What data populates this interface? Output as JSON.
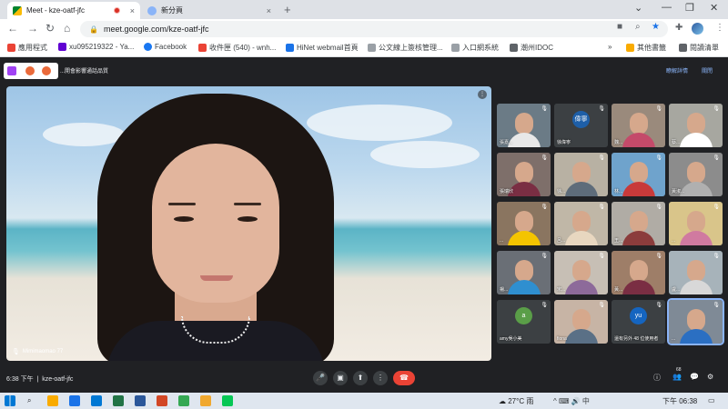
{
  "browser": {
    "tabs": [
      {
        "title": "Meet - kze-oatf-jfc",
        "active": true,
        "close": "×"
      },
      {
        "title": "新分頁",
        "active": false,
        "close": "×"
      }
    ],
    "new_tab": "+",
    "window_controls": {
      "minimize": "—",
      "restore": "❐",
      "close": "✕",
      "menu": "⌄"
    },
    "url": "meet.google.com/kze-oatf-jfc",
    "nav": {
      "back": "←",
      "forward": "→",
      "reload": "↻",
      "home": "⌂"
    },
    "omni_icons": {
      "camera": "■",
      "zoom": "⌕",
      "star": "★"
    },
    "ext_icons": {
      "puzzle": "✚",
      "menu": "⋮"
    }
  },
  "bookmarks": {
    "items": [
      {
        "label": "應用程式",
        "color": "#ea4335"
      },
      {
        "label": "xu095219322 - Ya...",
        "color": "#6001d2"
      },
      {
        "label": "Facebook",
        "color": "#1877f2"
      },
      {
        "label": "收件匣 (540) - wnh...",
        "color": "#ea4335"
      },
      {
        "label": "HiNet webmail首頁",
        "color": "#1a73e8"
      },
      {
        "label": "公文線上簽核管理...",
        "color": "#5f6368"
      },
      {
        "label": "入口網系統",
        "color": "#5f6368"
      },
      {
        "label": "潮州IDOC",
        "color": "#5f6368"
      }
    ],
    "more": "»",
    "other": "其他書籤",
    "reading": "閱讀清單"
  },
  "meet": {
    "strip_title": "...開會影響通話品質",
    "strip_links": [
      "瞭解詳情",
      "關閉"
    ],
    "main_speaker": "Mimimaomao 77",
    "participants": [
      {
        "name": "張嘉...",
        "bg": "#6b7b86",
        "body": "#e8e8e8"
      },
      {
        "name": "徐偉寧",
        "bg": "#3c4043",
        "avatar": "偉寧",
        "avatar_color": "#1e5fa8"
      },
      {
        "name": "魏...",
        "bg": "#9a8a7c",
        "body": "#c44a6a"
      },
      {
        "name": "蔡...",
        "bg": "#a7a7a0",
        "body": "#ffffff"
      },
      {
        "name": "張瑞欣",
        "bg": "#7e6f6a",
        "body": "#7a2e43"
      },
      {
        "name": "徐...",
        "bg": "#b8b1a3",
        "body": "#5e6c7a"
      },
      {
        "name": "林...",
        "bg": "#6fa3cc",
        "body": "#c83a3a"
      },
      {
        "name": "黃淑...",
        "bg": "#8c8c8c",
        "body": "#b0b0b0"
      },
      {
        "name": "...",
        "bg": "#8a7560",
        "body": "#f4c400"
      },
      {
        "name": "呂...",
        "bg": "#c0b7a7",
        "body": "#e8d7c0"
      },
      {
        "name": "王...",
        "bg": "#b0aca5",
        "body": "#8b3c3c"
      },
      {
        "name": "...",
        "bg": "#d9c58a",
        "body": "#d07aa0"
      },
      {
        "name": "楊...",
        "bg": "#6a6f76",
        "body": "#2f8fd0"
      },
      {
        "name": "宋...",
        "bg": "#c7bfb5",
        "body": "#8d6a9a"
      },
      {
        "name": "黃...",
        "bg": "#9e7e68",
        "body": "#7a2e43"
      },
      {
        "name": "盧...",
        "bg": "#a7b3ba",
        "body": "#d8d8d8"
      },
      {
        "name": "amy吳小美",
        "bg": "#3c4043",
        "avatar": "a",
        "avatar_color": "#5a9e48"
      },
      {
        "name": "fiona",
        "bg": "#c7b4a5",
        "body": "#5a7086"
      },
      {
        "name": "還有另外 48 位使用者",
        "bg": "#3c4043",
        "avatar": "yu",
        "avatar_color": "#1565c0"
      },
      {
        "name": "...",
        "bg": "#7f8a96",
        "body": "#2b6fc2"
      }
    ],
    "time": "6:38 下午",
    "meeting_code": "kze-oatf-jfc",
    "people_count": "68",
    "controls": {
      "mic": "🎤",
      "cam": "▣",
      "present": "⬆",
      "more": "⋮",
      "hangup": "☎"
    },
    "right_icons": {
      "info": "ⓘ",
      "people": "👥",
      "chat": "💬",
      "activities": "⚙"
    }
  },
  "taskbar": {
    "weather": "27°C 雨",
    "tray": "^  ⌨  🔊  中",
    "clock": "下午 06:38",
    "apps": [
      "#f9ab00",
      "#1a73e8",
      "#0078d4",
      "#217346",
      "#2b579a",
      "#d24726",
      "#34a853",
      "#f0a830",
      "#06c755"
    ]
  }
}
